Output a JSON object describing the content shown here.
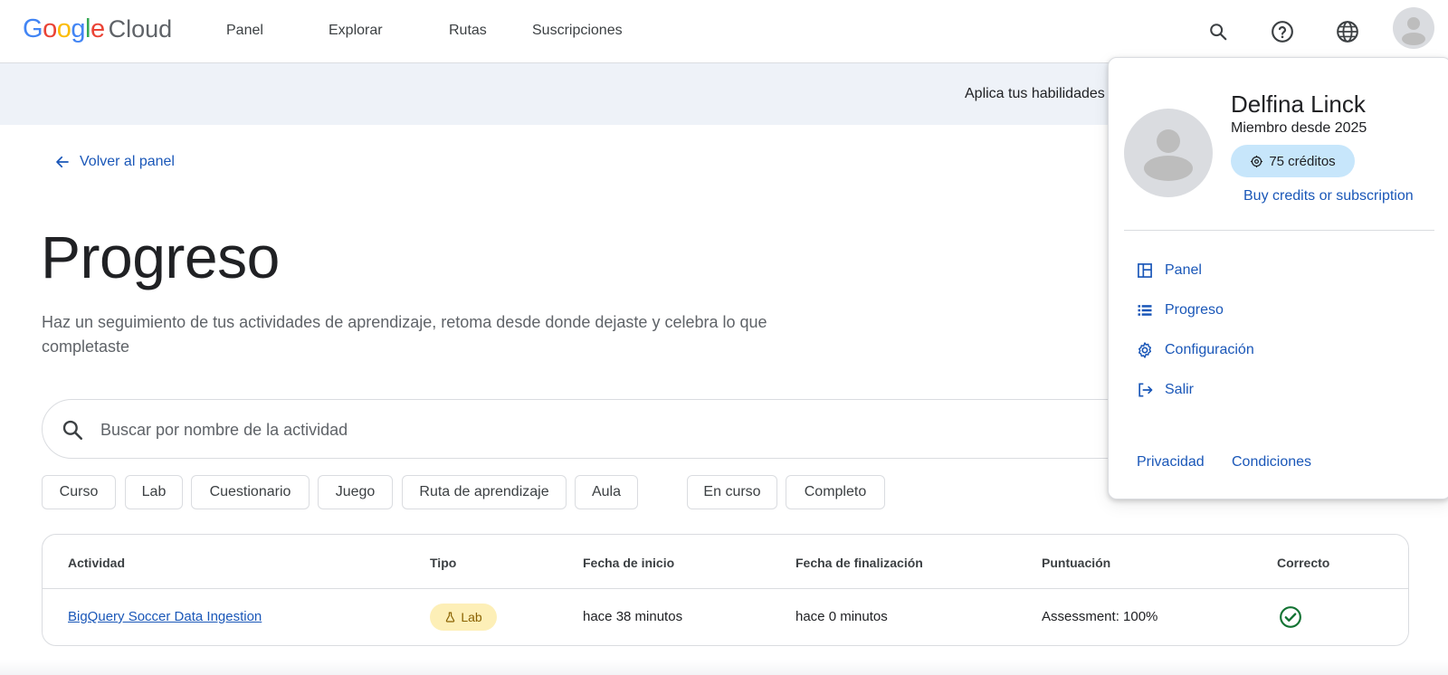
{
  "header": {
    "logo_google": "Google",
    "logo_cloud": "Cloud",
    "nav": [
      "Panel",
      "Explorar",
      "Rutas",
      "Suscripciones"
    ]
  },
  "banner": {
    "text": "Aplica tus habilidades"
  },
  "back_link": "Volver al panel",
  "page": {
    "title": "Progreso",
    "subtitle": "Haz un seguimiento de tus actividades de aprendizaje, retoma desde donde dejaste y celebra lo que completaste"
  },
  "search": {
    "placeholder": "Buscar por nombre de la actividad",
    "value": ""
  },
  "filters": {
    "type": [
      "Curso",
      "Lab",
      "Cuestionario",
      "Juego",
      "Ruta de aprendizaje",
      "Aula"
    ],
    "status": [
      "En curso",
      "Completo"
    ]
  },
  "table": {
    "headers": [
      "Actividad",
      "Tipo",
      "Fecha de inicio",
      "Fecha de finalización",
      "Puntuación",
      "Correcto"
    ],
    "rows": [
      {
        "activity": "BigQuery Soccer Data Ingestion",
        "type": "Lab",
        "start": "hace 38 minutos",
        "end": "hace 0 minutos",
        "score": "Assessment: 100%",
        "correct": true
      }
    ]
  },
  "profile": {
    "name": "Delfina Linck",
    "member_since": "Miembro desde 2025",
    "credits": "75 créditos",
    "buy": "Buy credits or subscription",
    "menu": [
      "Panel",
      "Progreso",
      "Configuración",
      "Salir"
    ],
    "footer": [
      "Privacidad",
      "Condiciones"
    ]
  },
  "colors": {
    "link": "#1a57b8",
    "credits_bg": "#c7e6fb",
    "lab_badge_bg": "#fdefb7",
    "success": "#137333"
  }
}
